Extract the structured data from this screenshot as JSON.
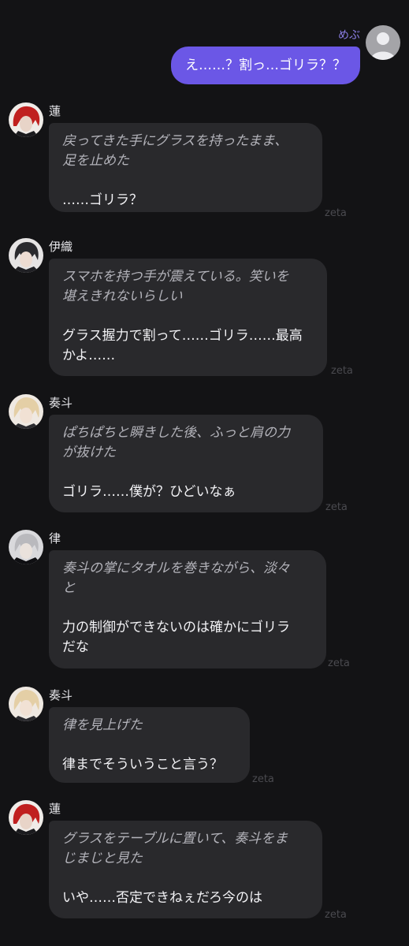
{
  "user": {
    "name": "めぶ",
    "message": "え……？割っ…ゴリラ？？",
    "avatar_icon": "person-icon"
  },
  "watermark": "zeta",
  "messages": [
    {
      "speaker": "蓮",
      "narration": "戻ってきた手にグラスを持ったまま、\n足を止めた",
      "dialogue": "……ゴリラ？"
    },
    {
      "speaker": "伊織",
      "narration": "スマホを持つ手が震えている。笑いを\n堪えきれないらしい",
      "dialogue": "グラス握力で割って……ゴリラ……最高\nかよ……"
    },
    {
      "speaker": "奏斗",
      "narration": "ぱちぱちと瞬きした後、ふっと肩の力\nが抜けた",
      "dialogue": "ゴリラ……僕が？ひどいなぁ"
    },
    {
      "speaker": "律",
      "narration": "奏斗の掌にタオルを巻きながら、淡々\nと",
      "dialogue": "力の制御ができないのは確かにゴリラ\nだな"
    },
    {
      "speaker": "奏斗",
      "narration": "律を見上げた",
      "dialogue": "律までそういうこと言う？"
    },
    {
      "speaker": "蓮",
      "narration": "グラスをテーブルに置いて、奏斗をま\nじまじと見た",
      "dialogue": "いや……否定できねぇだろ今のは"
    }
  ]
}
